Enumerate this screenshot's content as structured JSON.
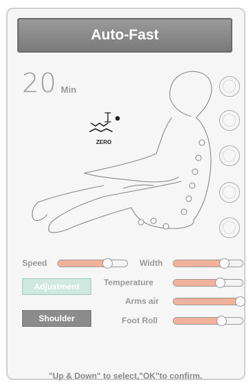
{
  "title": "Auto-Fast",
  "timer": {
    "value": "20",
    "unit": "Min"
  },
  "zero_gravity_label": "ZERO",
  "controls": {
    "speed": {
      "label": "Speed",
      "value": 0.72
    },
    "width": {
      "label": "Width",
      "value": 0.74
    },
    "temperature": {
      "label": "Temperature",
      "value": 0.68
    },
    "arms_air": {
      "label": "Arms air",
      "value": 0.97
    },
    "foot_roll": {
      "label": "Foot Roll",
      "value": 0.7
    }
  },
  "buttons": {
    "adjustment": "Adjustment",
    "shoulder": "Shoulder"
  },
  "hint": "\"Up & Down\" to select,\"OK\"to confirm.",
  "colors": {
    "slider_fill": "#f2b19b",
    "adjust_bg": "#cfe8e0",
    "shoulder_bg": "#8c8c8c",
    "title_bg": "#8a8a8a"
  }
}
